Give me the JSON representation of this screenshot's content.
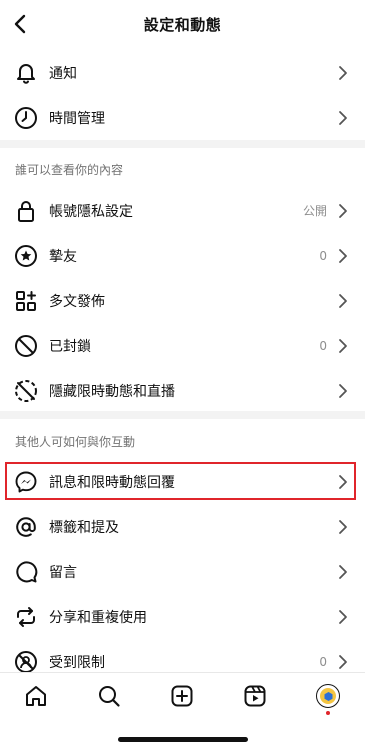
{
  "header": {
    "title": "設定和動態"
  },
  "rows_top": [
    {
      "label": "通知",
      "icon": "bell-icon"
    },
    {
      "label": "時間管理",
      "icon": "clock-icon"
    }
  ],
  "section_visibility": {
    "title": "誰可以查看你的內容",
    "items": [
      {
        "label": "帳號隱私設定",
        "value": "公開",
        "icon": "lock-icon"
      },
      {
        "label": "摯友",
        "value": "0",
        "icon": "star-circle-icon"
      },
      {
        "label": "多文發佈",
        "value": "",
        "icon": "grid-plus-icon"
      },
      {
        "label": "已封鎖",
        "value": "0",
        "icon": "block-icon"
      },
      {
        "label": "隱藏限時動態和直播",
        "value": "",
        "icon": "hide-story-icon"
      }
    ]
  },
  "section_interaction": {
    "title": "其他人可如何與你互動",
    "items": [
      {
        "label": "訊息和限時動態回覆",
        "value": "",
        "icon": "messenger-icon"
      },
      {
        "label": "標籤和提及",
        "value": "",
        "icon": "at-sign-icon"
      },
      {
        "label": "留言",
        "value": "",
        "icon": "comment-icon"
      },
      {
        "label": "分享和重複使用",
        "value": "",
        "icon": "repost-icon"
      },
      {
        "label": "受到限制",
        "value": "0",
        "icon": "restricted-icon"
      }
    ]
  },
  "tabbar": {
    "items": [
      "home-icon",
      "search-icon",
      "create-icon",
      "reels-icon",
      "profile-avatar"
    ],
    "accent": "#e0252b"
  }
}
